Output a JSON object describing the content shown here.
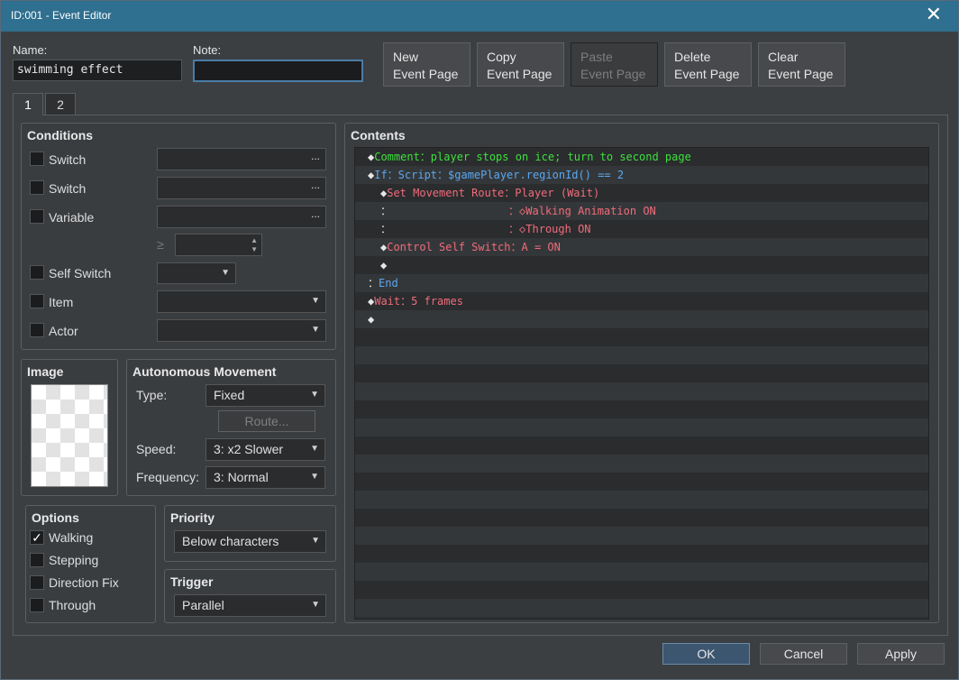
{
  "window": {
    "title": "ID:001 - Event Editor",
    "close_glyph": "✕"
  },
  "header": {
    "name_label": "Name:",
    "name_value": "swimming effect",
    "note_label": "Note:",
    "note_value": "",
    "buttons": [
      {
        "line1": "New",
        "line2": "Event Page",
        "enabled": true
      },
      {
        "line1": "Copy",
        "line2": "Event Page",
        "enabled": true
      },
      {
        "line1": "Paste",
        "line2": "Event Page",
        "enabled": false
      },
      {
        "line1": "Delete",
        "line2": "Event Page",
        "enabled": true
      },
      {
        "line1": "Clear",
        "line2": "Event Page",
        "enabled": true
      }
    ]
  },
  "tabs": [
    {
      "label": "1",
      "active": true
    },
    {
      "label": "2",
      "active": false
    }
  ],
  "conditions": {
    "title": "Conditions",
    "switch1": "Switch",
    "switch2": "Switch",
    "variable": "Variable",
    "gte_symbol": "≥",
    "self_switch": "Self Switch",
    "item": "Item",
    "actor": "Actor",
    "dots": "..."
  },
  "image": {
    "title": "Image"
  },
  "autonomous": {
    "title": "Autonomous Movement",
    "type_label": "Type:",
    "type_value": "Fixed",
    "route_button": "Route...",
    "speed_label": "Speed:",
    "speed_value": "3: x2 Slower",
    "freq_label": "Frequency:",
    "freq_value": "3: Normal"
  },
  "options": {
    "title": "Options",
    "walking": "Walking",
    "walking_checked": true,
    "stepping": "Stepping",
    "direction_fix": "Direction Fix",
    "through": "Through",
    "check_glyph": "✓"
  },
  "priority": {
    "title": "Priority",
    "value": "Below characters"
  },
  "trigger": {
    "title": "Trigger",
    "value": "Parallel"
  },
  "contents": {
    "title": "Contents",
    "rows": [
      {
        "prefix": "◆",
        "text": "Comment：player stops on ice; turn to second page",
        "color": "green",
        "indent": 0
      },
      {
        "prefix": "◆",
        "text": "If：Script：$gamePlayer.regionId() == 2",
        "color": "blue",
        "indent": 0
      },
      {
        "prefix": "◆",
        "text": "Set Movement Route：Player (Wait)",
        "color": "pink-white",
        "indent": 1
      },
      {
        "prefix": "：",
        "text": "                  ：◇Walking Animation ON",
        "color": "pink",
        "indent": 1
      },
      {
        "prefix": "：",
        "text": "                  ：◇Through ON",
        "color": "pink",
        "indent": 1
      },
      {
        "prefix": "◆",
        "text": "Control Self Switch：A = ON",
        "color": "pink",
        "indent": 1
      },
      {
        "prefix": "◆",
        "text": "",
        "color": "white",
        "indent": 1
      },
      {
        "prefix": "：",
        "text": "End",
        "color": "blue",
        "indent": 0
      },
      {
        "prefix": "◆",
        "text": "Wait：5 frames",
        "color": "pink",
        "indent": 0
      },
      {
        "prefix": "◆",
        "text": "",
        "color": "white",
        "indent": 0
      }
    ]
  },
  "footer": {
    "ok": "OK",
    "cancel": "Cancel",
    "apply": "Apply"
  },
  "icons": {
    "combo_arrow": "▼",
    "spin_up": "▲",
    "spin_down": "▼"
  }
}
